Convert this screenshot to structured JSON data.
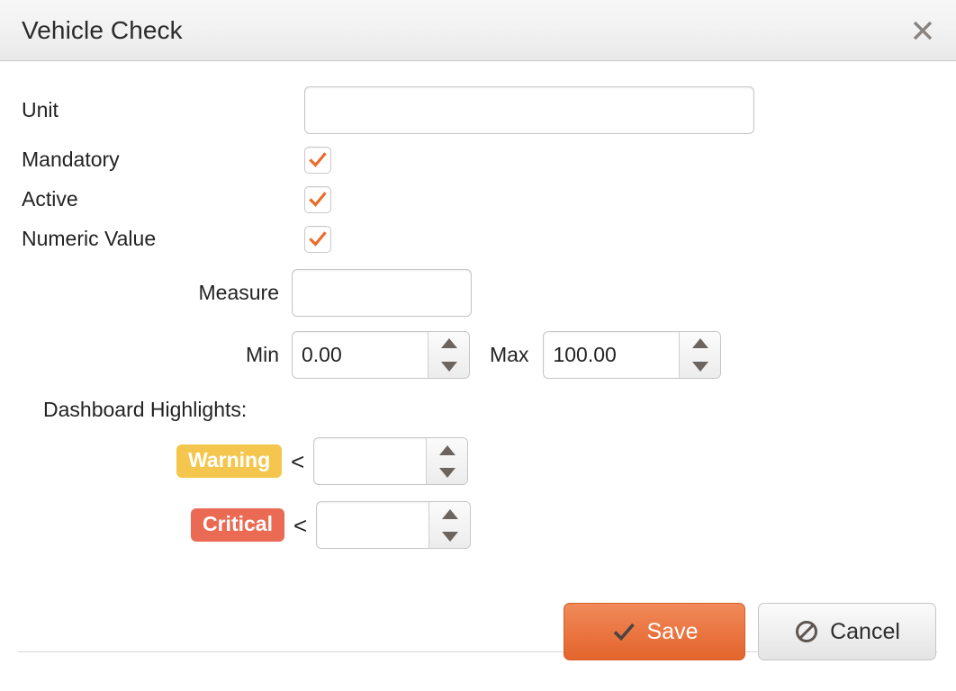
{
  "dialog": {
    "title": "Vehicle Check",
    "close_icon": "close-icon"
  },
  "form": {
    "unit": {
      "label": "Unit",
      "value": "",
      "placeholder": ""
    },
    "mandatory": {
      "label": "Mandatory",
      "checked": true
    },
    "active": {
      "label": "Active",
      "checked": true
    },
    "numeric_value": {
      "label": "Numeric Value",
      "checked": true
    },
    "measure": {
      "label": "Measure",
      "value": "",
      "placeholder": ""
    },
    "min": {
      "label": "Min",
      "value": "0.00"
    },
    "max": {
      "label": "Max",
      "value": "100.00"
    }
  },
  "dashboard_highlights": {
    "section_label": "Dashboard Highlights:",
    "warning": {
      "badge": "Warning",
      "operator": "<",
      "value": "",
      "color": "#f4c64d"
    },
    "critical": {
      "badge": "Critical",
      "operator": "<",
      "value": "",
      "color": "#ea6a54"
    }
  },
  "footer": {
    "save_label": "Save",
    "save_icon": "check-icon",
    "save_color": "#ea7440",
    "cancel_label": "Cancel",
    "cancel_icon": "ban-icon"
  }
}
